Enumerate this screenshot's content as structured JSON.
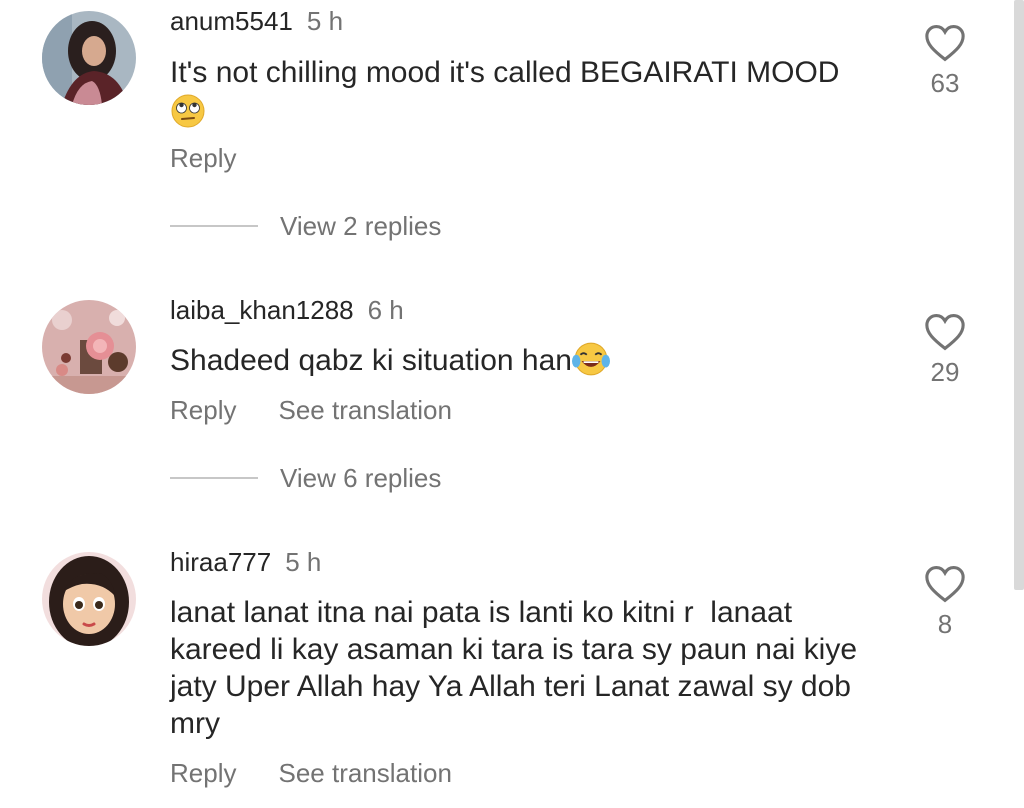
{
  "comments": [
    {
      "username": "anum5541",
      "time": "5 h",
      "text": "It's not chilling mood it's called BEGAIRATI MOOD",
      "emoji": "face-with-rolling-eyes-emoji",
      "reply_label": "Reply",
      "likes": "63",
      "view_replies": "View 2 replies"
    },
    {
      "username": "laiba_khan1288",
      "time": "6 h",
      "text": "Shadeed qabz ki situation han",
      "emoji": "face-with-tears-of-joy-emoji",
      "reply_label": "Reply",
      "translate_label": "See translation",
      "likes": "29",
      "view_replies": "View 6 replies"
    },
    {
      "username": "hiraa777",
      "time": "5 h",
      "text_lines": [
        "lanat lanat itna nai pata is lanti ko kitni r  lanaat",
        "kareed li kay asaman ki tara is tara sy paun nai kiye",
        "jaty Uper Allah hay Ya Allah teri Lanat zawal sy dob",
        "mry"
      ],
      "reply_label": "Reply",
      "translate_label": "See translation",
      "likes": "8"
    }
  ],
  "colors": {
    "primary_text": "#262626",
    "secondary_text": "#737373",
    "divider": "#c7c7c7",
    "background": "#ffffff"
  }
}
